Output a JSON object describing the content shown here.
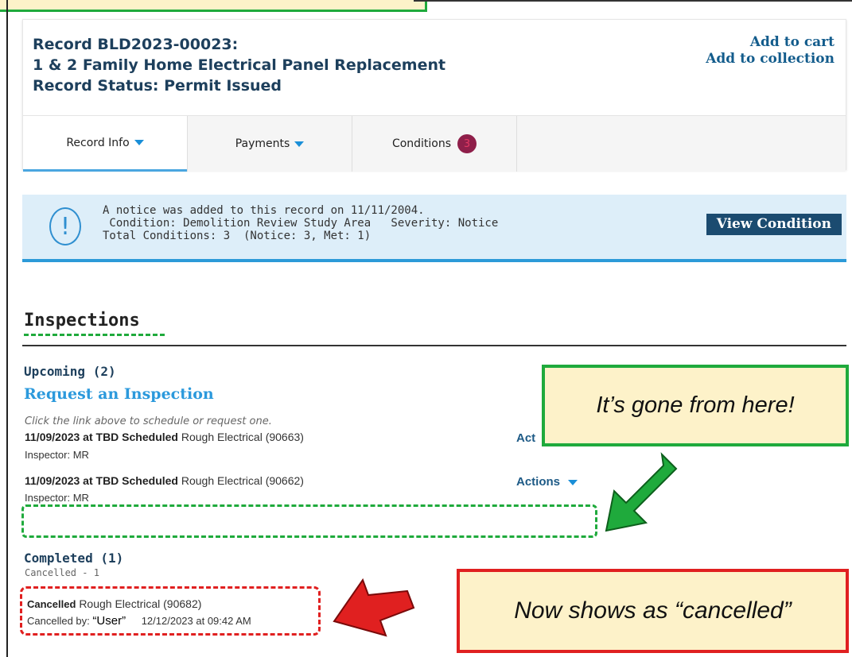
{
  "record": {
    "title_line1": "Record BLD2023-00023:",
    "title_line2": "1 & 2 Family Home Electrical Panel Replacement",
    "title_line3": "Record Status: Permit Issued",
    "add_to_cart": "Add to cart",
    "add_to_collection": "Add to collection"
  },
  "tabs": [
    {
      "label": "Record Info"
    },
    {
      "label": "Payments"
    },
    {
      "label": "Conditions",
      "badge": "3"
    }
  ],
  "notice": {
    "line1": "A notice was added to this record on 11/11/2004.",
    "line2": " Condition: Demolition Review Study Area   Severity: Notice",
    "line3": "Total Conditions: 3  (Notice: 3, Met: 1)",
    "button": "View Condition"
  },
  "inspections": {
    "title": "Inspections",
    "upcoming_label": "Upcoming (2)",
    "request_link": "Request an Inspection",
    "hint": "Click the link above to schedule or request one.",
    "upcoming": [
      {
        "date_status": "11/09/2023 at TBD Scheduled",
        "name": "Rough Electrical (90663)",
        "inspector": "Inspector: MR",
        "actions": "Act"
      },
      {
        "date_status": "11/09/2023 at TBD Scheduled",
        "name": "Rough Electrical (90662)",
        "inspector": "Inspector: MR",
        "actions": "Actions"
      }
    ],
    "completed_label": "Completed (1)",
    "cancelled_count": "Cancelled - 1",
    "completed": [
      {
        "status": "Cancelled",
        "name": "Rough Electrical (90682)",
        "cancelled_by_label": "Cancelled by:",
        "cancelled_by": "“User”",
        "datetime": "12/12/2023 at 09:42 AM"
      }
    ]
  },
  "callouts": {
    "green": "It’s gone from here!",
    "red": "Now shows as “cancelled”"
  },
  "colors": {
    "green": "#1faa3c",
    "red": "#e02020",
    "callout_bg": "#fdf2c9",
    "title_navy": "#1d3f5c",
    "link_blue": "#2b99dc"
  }
}
